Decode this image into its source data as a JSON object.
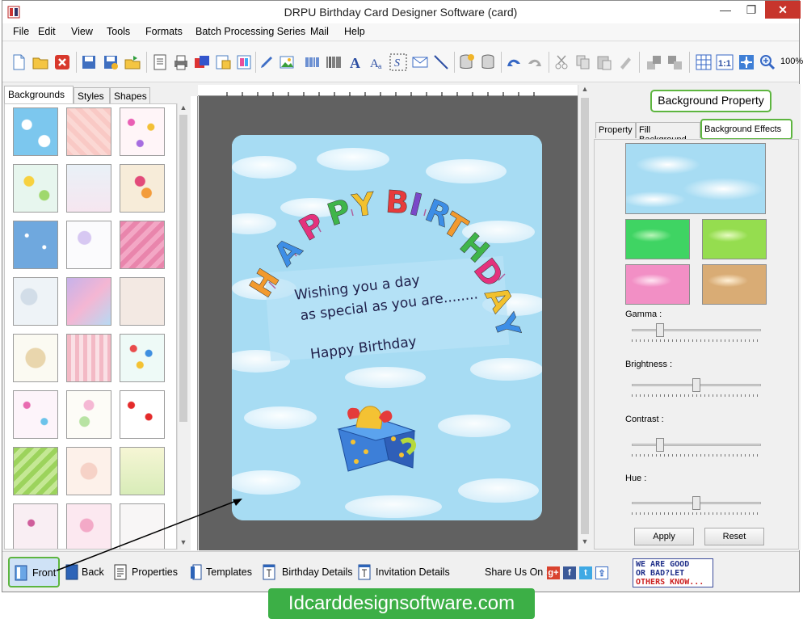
{
  "window": {
    "title": "DRPU Birthday Card Designer Software (card)",
    "controls": {
      "minimize": "—",
      "maximize": "❐",
      "close": "✕"
    }
  },
  "menu": [
    "File",
    "Edit",
    "View",
    "Tools",
    "Formats",
    "Batch Processing Series",
    "Mail",
    "Help"
  ],
  "toolbar": {
    "zoom": "100%"
  },
  "left_panel": {
    "tabs": [
      "Backgrounds",
      "Styles",
      "Shapes"
    ],
    "active_tab": "Backgrounds"
  },
  "card": {
    "headline": "HAPPY BIRTHDAY",
    "wish_line1": "Wishing you a day",
    "wish_line2": "as special as you are........",
    "greeting": "Happy Birthday"
  },
  "right_panel": {
    "title": "Background Property",
    "tabs": [
      "Property",
      "Fill Background",
      "Background Effects"
    ],
    "active_tab": "Background Effects",
    "sliders": {
      "gamma": {
        "label": "Gamma :",
        "value": 0.2
      },
      "brightness": {
        "label": "Brightness :",
        "value": 0.5
      },
      "contrast": {
        "label": "Contrast :",
        "value": 0.2
      },
      "hue": {
        "label": "Hue :",
        "value": 0.5
      }
    },
    "apply_label": "Apply",
    "reset_label": "Reset"
  },
  "bottom_bar": {
    "items": [
      "Front",
      "Back",
      "Properties",
      "Templates",
      "Birthday Details",
      "Invitation Details"
    ],
    "share_label": "Share Us On :",
    "social": [
      "g+",
      "f",
      "t",
      "share"
    ],
    "good_bad": {
      "line1": "WE ARE GOOD",
      "line2": "OR BAD?LET",
      "line3": "OTHERS KNOW..."
    }
  },
  "footer": {
    "text": "Idcarddesignsoftware.com"
  },
  "colors": {
    "accent_green": "#5db53f",
    "sky": "#a7dcf3",
    "close_red": "#c7352c"
  }
}
